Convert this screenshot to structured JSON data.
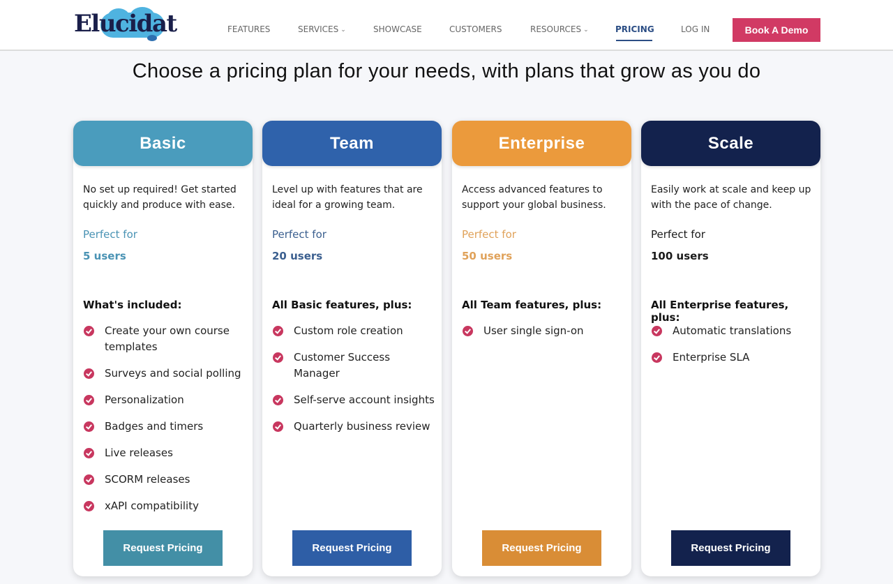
{
  "header": {
    "logo_text": "Elucidat",
    "nav": [
      {
        "label": "FEATURES",
        "dropdown": false,
        "active": false
      },
      {
        "label": "SERVICES",
        "dropdown": true,
        "active": false
      },
      {
        "label": "SHOWCASE",
        "dropdown": false,
        "active": false
      },
      {
        "label": "CUSTOMERS",
        "dropdown": false,
        "active": false
      },
      {
        "label": "RESOURCES",
        "dropdown": true,
        "active": false
      },
      {
        "label": "PRICING",
        "dropdown": false,
        "active": true
      },
      {
        "label": "LOG IN",
        "dropdown": false,
        "active": false
      }
    ],
    "chevron_glyph": "⌄",
    "cta_label": "Book A Demo",
    "cta_color": "#d13a64"
  },
  "headline": "Choose a pricing plan for your needs, with plans that grow as you do",
  "plans": [
    {
      "name": "Basic",
      "color": "#4a9cbd",
      "accent_text_color": "#4a93b4",
      "description": "No set up required! Get started quickly and produce with ease.",
      "perfect_for_label": "Perfect for",
      "users": "5 users",
      "included_heading": "What's included:",
      "features": [
        "Create your own course templates",
        "Surveys and social polling",
        "Personalization",
        "Badges and timers",
        "Live releases",
        "SCORM releases",
        "xAPI compatibility"
      ],
      "button_label": "Request Pricing",
      "button_color": "#438fa6"
    },
    {
      "name": "Team",
      "color": "#2f62ab",
      "accent_text_color": "#3b5f8f",
      "description": "Level up with features that are ideal for a growing team.",
      "perfect_for_label": "Perfect for",
      "users": "20 users",
      "included_heading": "All Basic features, plus:",
      "features": [
        "Custom role creation",
        "Customer Success Manager",
        "Self-serve account insights",
        "Quarterly business review"
      ],
      "button_label": "Request Pricing",
      "button_color": "#2e5ea6"
    },
    {
      "name": "Enterprise",
      "color": "#eb9a3c",
      "accent_text_color": "#e0a25a",
      "description": "Access advanced features to support your global business.",
      "perfect_for_label": "Perfect for",
      "users": "50 users",
      "included_heading": "All Team features, plus:",
      "features": [
        "User single sign-on"
      ],
      "button_label": "Request Pricing",
      "button_color": "#d98d36"
    },
    {
      "name": "Scale",
      "color": "#13224d",
      "accent_text_color": "#1a1a1a",
      "description": "Easily work at scale and keep up with the pace of change.",
      "perfect_for_label": "Perfect for",
      "users": "100 users",
      "included_heading": "All Enterprise features, plus:",
      "features": [
        "Automatic translations",
        "Enterprise SLA"
      ],
      "button_label": "Request Pricing",
      "button_color": "#13224d"
    }
  ],
  "check_icon_color": "#c8375f"
}
